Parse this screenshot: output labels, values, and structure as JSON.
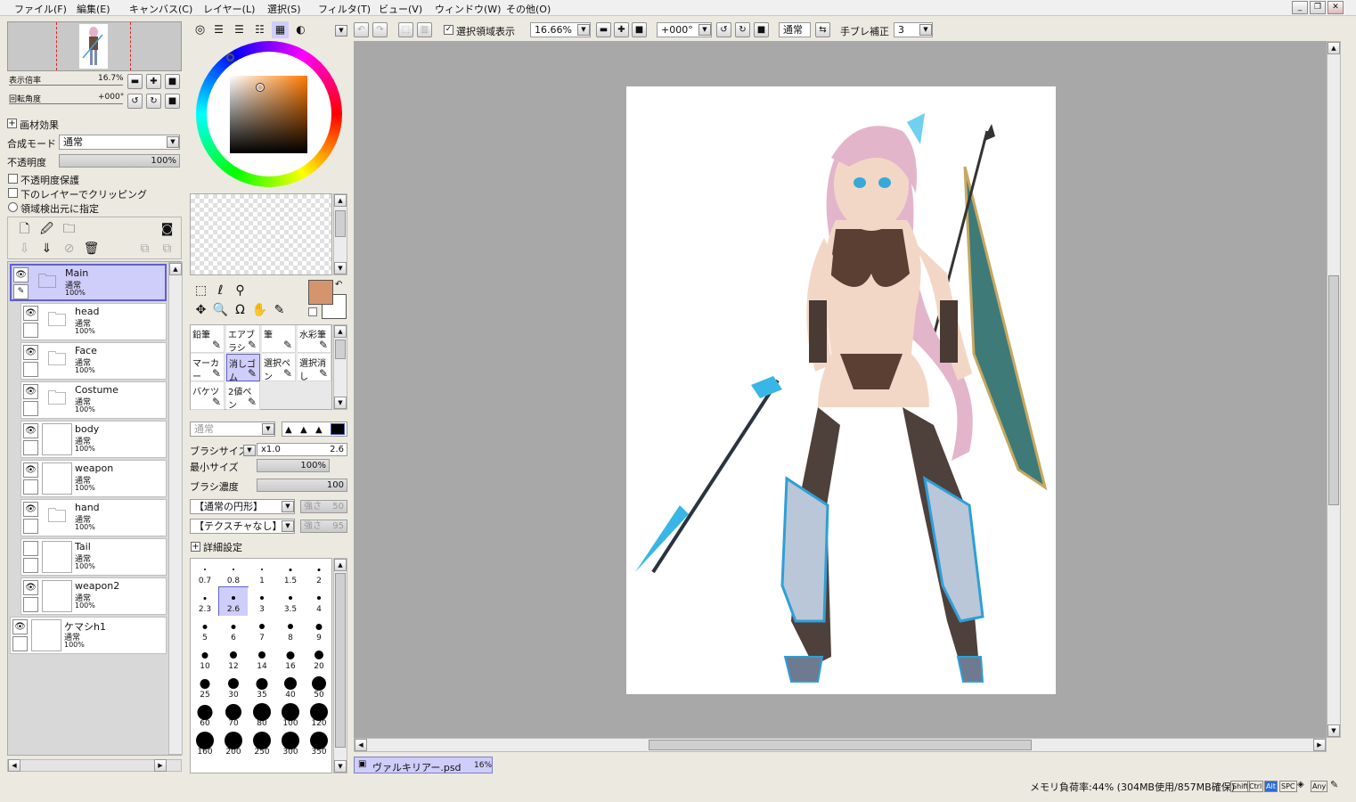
{
  "menu": [
    "ファイル(F)",
    "編集(E)",
    "キャンバス(C)",
    "レイヤー(L)",
    "選択(S)",
    "フィルタ(T)",
    "ビュー(V)",
    "ウィンドウ(W)",
    "その他(O)"
  ],
  "window_buttons": [
    "_",
    "❐",
    "✕"
  ],
  "navigator": {
    "zoom_label": "表示倍率",
    "zoom_value": "16.7%",
    "angle_label": "回転角度",
    "angle_value": "+000°"
  },
  "paper": {
    "header": "画材効果",
    "blend_label": "合成モード",
    "blend_value": "通常",
    "opacity_label": "不透明度",
    "opacity_value": "100%",
    "chk_protect": "不透明度保護",
    "chk_clip": "下のレイヤーでクリッピング",
    "radio_source": "領域検出元に指定"
  },
  "layers": [
    {
      "name": "Main",
      "mode": "通常",
      "opacity": "100%",
      "type": "folder",
      "selected": true,
      "visible": true
    },
    {
      "name": "head",
      "mode": "通常",
      "opacity": "100%",
      "type": "folder",
      "visible": true
    },
    {
      "name": "Face",
      "mode": "通常",
      "opacity": "100%",
      "type": "folder",
      "visible": true
    },
    {
      "name": "Costume",
      "mode": "通常",
      "opacity": "100%",
      "type": "folder",
      "visible": true
    },
    {
      "name": "body",
      "mode": "通常",
      "opacity": "100%",
      "type": "image",
      "visible": true
    },
    {
      "name": "weapon",
      "mode": "通常",
      "opacity": "100%",
      "type": "image",
      "visible": true
    },
    {
      "name": "hand",
      "mode": "通常",
      "opacity": "100%",
      "type": "folder",
      "visible": true
    },
    {
      "name": "Tail",
      "mode": "通常",
      "opacity": "100%",
      "type": "image",
      "visible": false
    },
    {
      "name": "weapon2",
      "mode": "通常",
      "opacity": "100%",
      "type": "image",
      "visible": true
    },
    {
      "name": "ケマシh1",
      "mode": "通常",
      "opacity": "100%",
      "type": "image",
      "visible": true
    }
  ],
  "toolbar": {
    "selection_show": "選択領域表示",
    "zoom": "16.66%",
    "angle": "+000°",
    "blend": "通常",
    "stabilizer_label": "手ブレ補正",
    "stabilizer_value": "3"
  },
  "brushes": [
    [
      "鉛筆",
      "エアブラシ",
      "筆",
      "水彩筆"
    ],
    [
      "マーカー",
      "消しゴム",
      "選択ペン",
      "選択消し"
    ],
    [
      "バケツ",
      "2値ペン"
    ]
  ],
  "brush_settings": {
    "mode": "通常",
    "size_label": "ブラシサイズ",
    "size_mult": "x1.0",
    "size_value": "2.6",
    "min_label": "最小サイズ",
    "min_value": "100%",
    "density_label": "ブラシ濃度",
    "density_value": "100",
    "shape": "【通常の円形】",
    "shape_strength_label": "強さ",
    "shape_strength": "50",
    "texture": "【テクスチャなし】",
    "texture_strength_label": "強さ",
    "texture_strength": "95",
    "detail": "詳細設定"
  },
  "brush_sizes": [
    "0.7",
    "0.8",
    "1",
    "1.5",
    "2",
    "2.3",
    "2.6",
    "3",
    "3.5",
    "4",
    "5",
    "6",
    "7",
    "8",
    "9",
    "10",
    "12",
    "14",
    "16",
    "20",
    "25",
    "30",
    "35",
    "40",
    "50",
    "60",
    "70",
    "80",
    "100",
    "120",
    "160",
    "200",
    "250",
    "300",
    "350"
  ],
  "selected_size": "2.6",
  "document_tab": {
    "name": "ヴァルキリアー.psd",
    "zoom": "16%"
  },
  "status": {
    "memory": "メモリ負荷率:44% (304MB使用/857MB確保)",
    "keys": [
      "Shift",
      "Ctrl",
      "Alt",
      "SPC",
      "Any"
    ]
  },
  "colors": {
    "current_color": "#d4956e",
    "accent": "#cfcdfa",
    "canvas_bg": "#a8a8a8"
  }
}
